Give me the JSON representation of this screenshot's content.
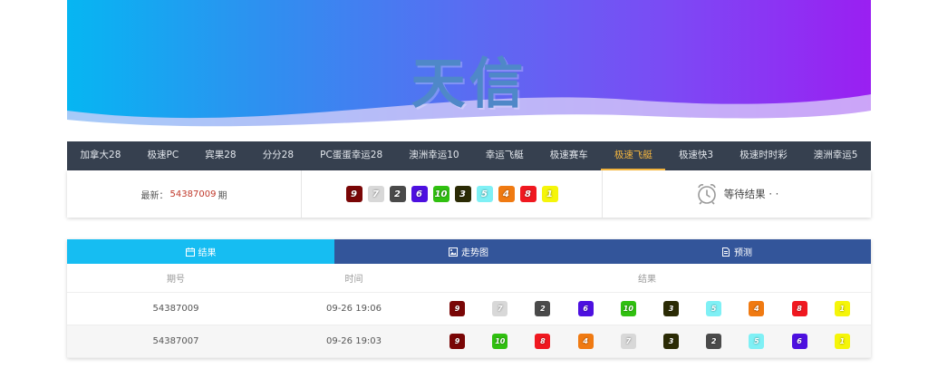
{
  "banner": {
    "title": "天信"
  },
  "nav": {
    "items": [
      {
        "label": "加拿大28",
        "active": false
      },
      {
        "label": "极速PC",
        "active": false
      },
      {
        "label": "宾果28",
        "active": false
      },
      {
        "label": "分分28",
        "active": false
      },
      {
        "label": "PC蛋蛋幸运28",
        "active": false
      },
      {
        "label": "澳洲幸运10",
        "active": false
      },
      {
        "label": "幸运飞艇",
        "active": false
      },
      {
        "label": "极速赛车",
        "active": false
      },
      {
        "label": "极速飞艇",
        "active": true
      },
      {
        "label": "极速快3",
        "active": false
      },
      {
        "label": "极速时时彩",
        "active": false
      },
      {
        "label": "澳洲幸运5",
        "active": false
      }
    ]
  },
  "latest": {
    "prefix": "最新：",
    "issue": "54387009",
    "suffix": "期",
    "numbers": [
      "9",
      "7",
      "2",
      "6",
      "10",
      "3",
      "5",
      "4",
      "8",
      "1"
    ],
    "status": "等待结果 · ·"
  },
  "ball_colors": {
    "1": "#f5f50a",
    "2": "#4a4a4a",
    "3": "#2b2b05",
    "4": "#f07a12",
    "5": "#7ff0f5",
    "6": "#4d10e0",
    "7": "#d8d8d8",
    "8": "#f01820",
    "9": "#7a0606",
    "10": "#30c010"
  },
  "results": {
    "tabs": [
      {
        "label": "结果",
        "icon": "calendar-icon"
      },
      {
        "label": "走势图",
        "icon": "image-icon"
      },
      {
        "label": "预测",
        "icon": "document-icon"
      }
    ],
    "headers": {
      "issue": "期号",
      "time": "时间",
      "result": "结果"
    },
    "rows": [
      {
        "issue": "54387009",
        "time": "09-26 19:06",
        "numbers": [
          "9",
          "7",
          "2",
          "6",
          "10",
          "3",
          "5",
          "4",
          "8",
          "1"
        ]
      },
      {
        "issue": "54387007",
        "time": "09-26 19:03",
        "numbers": [
          "9",
          "10",
          "8",
          "4",
          "7",
          "3",
          "2",
          "5",
          "6",
          "1"
        ]
      }
    ]
  }
}
